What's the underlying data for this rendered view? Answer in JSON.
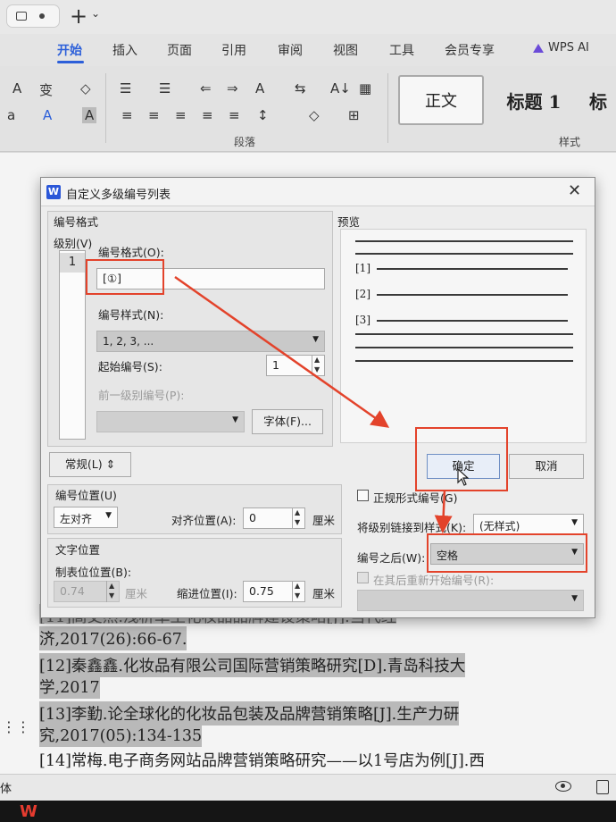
{
  "titlebar": {
    "plus": "+",
    "plus_chevron": "⌄"
  },
  "menu": {
    "items": [
      "开始",
      "插入",
      "页面",
      "引用",
      "审阅",
      "视图",
      "工具",
      "会员专享",
      "WPS AI"
    ],
    "active_color": "#2c5fd9"
  },
  "ribbon": {
    "row1_icons": [
      "A",
      "变",
      "◇",
      "☰",
      "☰",
      "⇐",
      "⇒",
      "A",
      "⇆",
      "A↓",
      "▦"
    ],
    "row2_icons": [
      "a",
      "A",
      "A",
      "≡",
      "≡",
      "≡",
      "≡",
      "≡",
      "↕",
      "◇",
      "⊞"
    ],
    "group_paragraph": "段落",
    "group_style": "样式",
    "styles": {
      "normal": "正文",
      "heading1": "标题 1",
      "heading2": "标"
    }
  },
  "dialog": {
    "title": "自定义多级编号列表",
    "close": "✕",
    "section_format": "编号格式",
    "level_label": "级别(V)",
    "level_value": "1",
    "number_format_label": "编号格式(O):",
    "number_format_value": "[①]",
    "number_style_label": "编号样式(N):",
    "number_style_value": "1, 2, 3, ...",
    "start_at_label": "起始编号(S):",
    "start_at_value": "1",
    "prev_level_label": "前一级别编号(P):",
    "font_button": "字体(F)...",
    "preview_label": "预览",
    "preview_numbers": [
      "[1]",
      "[2]",
      "[3]"
    ],
    "normal_button": "常规(L) ⇕",
    "ok_button": "确定",
    "cancel_button": "取消",
    "number_position_label": "编号位置(U)",
    "align_value": "左对齐",
    "align_at_label": "对齐位置(A):",
    "align_at_value": "0",
    "unit_cm": "厘米",
    "text_position_label": "文字位置",
    "tab_stop_label": "制表位位置(B):",
    "tab_stop_value": "0.74",
    "indent_label": "缩进位置(I):",
    "indent_value": "0.75",
    "legal_style_label": "正规形式编号(G)",
    "link_style_label": "将级别链接到样式(K):",
    "link_style_value": "(无样式)",
    "follow_label": "编号之后(W):",
    "follow_value": "空格",
    "restart_label": "在其后重新开始编号(R):"
  },
  "document": {
    "lines": [
      "[11]高丈然.浅析革土化妆品品牌建设策略[J].当代经",
      "济,2017(26):66-67.",
      "[12]秦鑫鑫.化妆品有限公司国际营销策略研究[D].青岛科技大",
      "学,2017",
      "[13]李勤.论全球化的化妆品包装及品牌营销策略[J].生产力研",
      "究,2017(05):134-135",
      "[14]常梅.电子商务网站品牌营销策略研究——以1号店为例[J].西"
    ]
  },
  "statusbar": {
    "font_label": "体"
  },
  "taskbar": {
    "app_letter": "W"
  }
}
